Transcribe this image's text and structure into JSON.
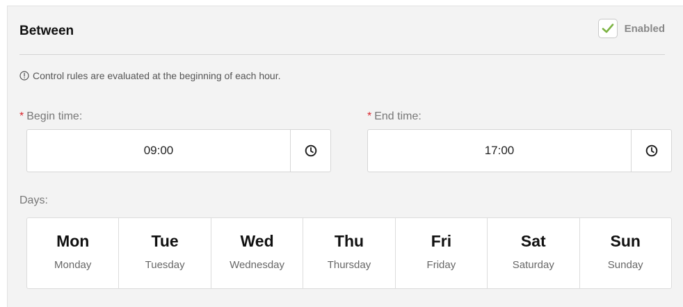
{
  "section": {
    "title": "Between",
    "enabled_label": "Enabled",
    "enabled_checked": true
  },
  "info": {
    "icon": "info-circle-icon",
    "text": "Control rules are evaluated at the beginning of each hour."
  },
  "begin_time": {
    "required_marker": "*",
    "label": "Begin time:",
    "value": "09:00",
    "icon": "clock-icon"
  },
  "end_time": {
    "required_marker": "*",
    "label": "End time:",
    "value": "17:00",
    "icon": "clock-icon"
  },
  "days": {
    "label": "Days:",
    "items": [
      {
        "short": "Mon",
        "long": "Monday"
      },
      {
        "short": "Tue",
        "long": "Tuesday"
      },
      {
        "short": "Wed",
        "long": "Wednesday"
      },
      {
        "short": "Thu",
        "long": "Thursday"
      },
      {
        "short": "Fri",
        "long": "Friday"
      },
      {
        "short": "Sat",
        "long": "Saturday"
      },
      {
        "short": "Sun",
        "long": "Sunday"
      }
    ]
  },
  "colors": {
    "required": "#d9262d",
    "check": "#7cb342",
    "panel_bg": "#f3f3f3"
  }
}
